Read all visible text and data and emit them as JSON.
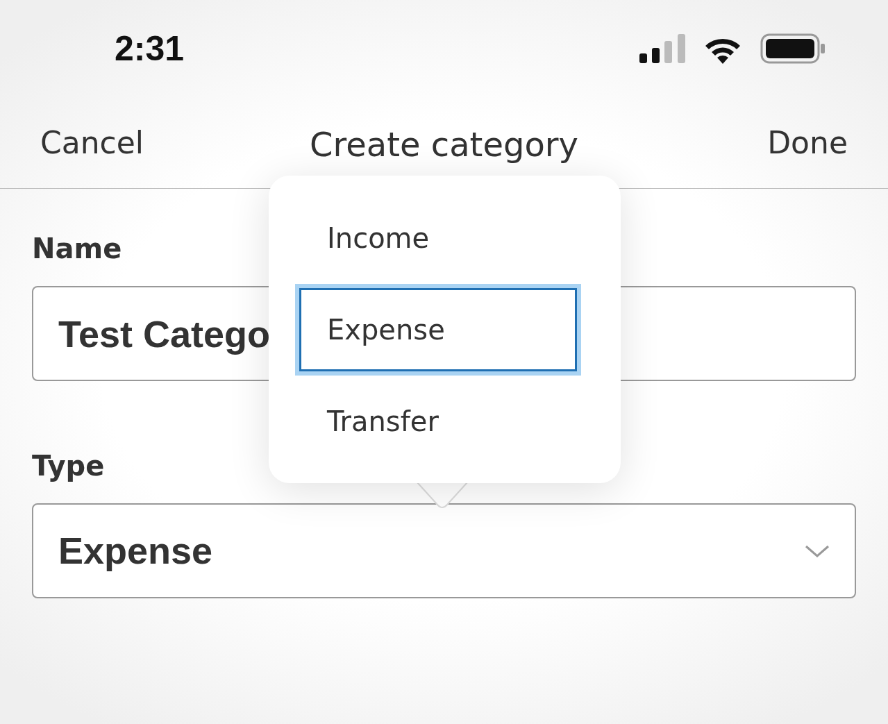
{
  "status_bar": {
    "time": "2:31"
  },
  "nav": {
    "cancel": "Cancel",
    "title": "Create category",
    "done": "Done"
  },
  "form": {
    "name_label": "Name",
    "name_value": "Test Catego",
    "type_label": "Type",
    "type_value": "Expense"
  },
  "popover": {
    "items": [
      {
        "label": "Income",
        "selected": false
      },
      {
        "label": "Expense",
        "selected": true
      },
      {
        "label": "Transfer",
        "selected": false
      }
    ]
  }
}
